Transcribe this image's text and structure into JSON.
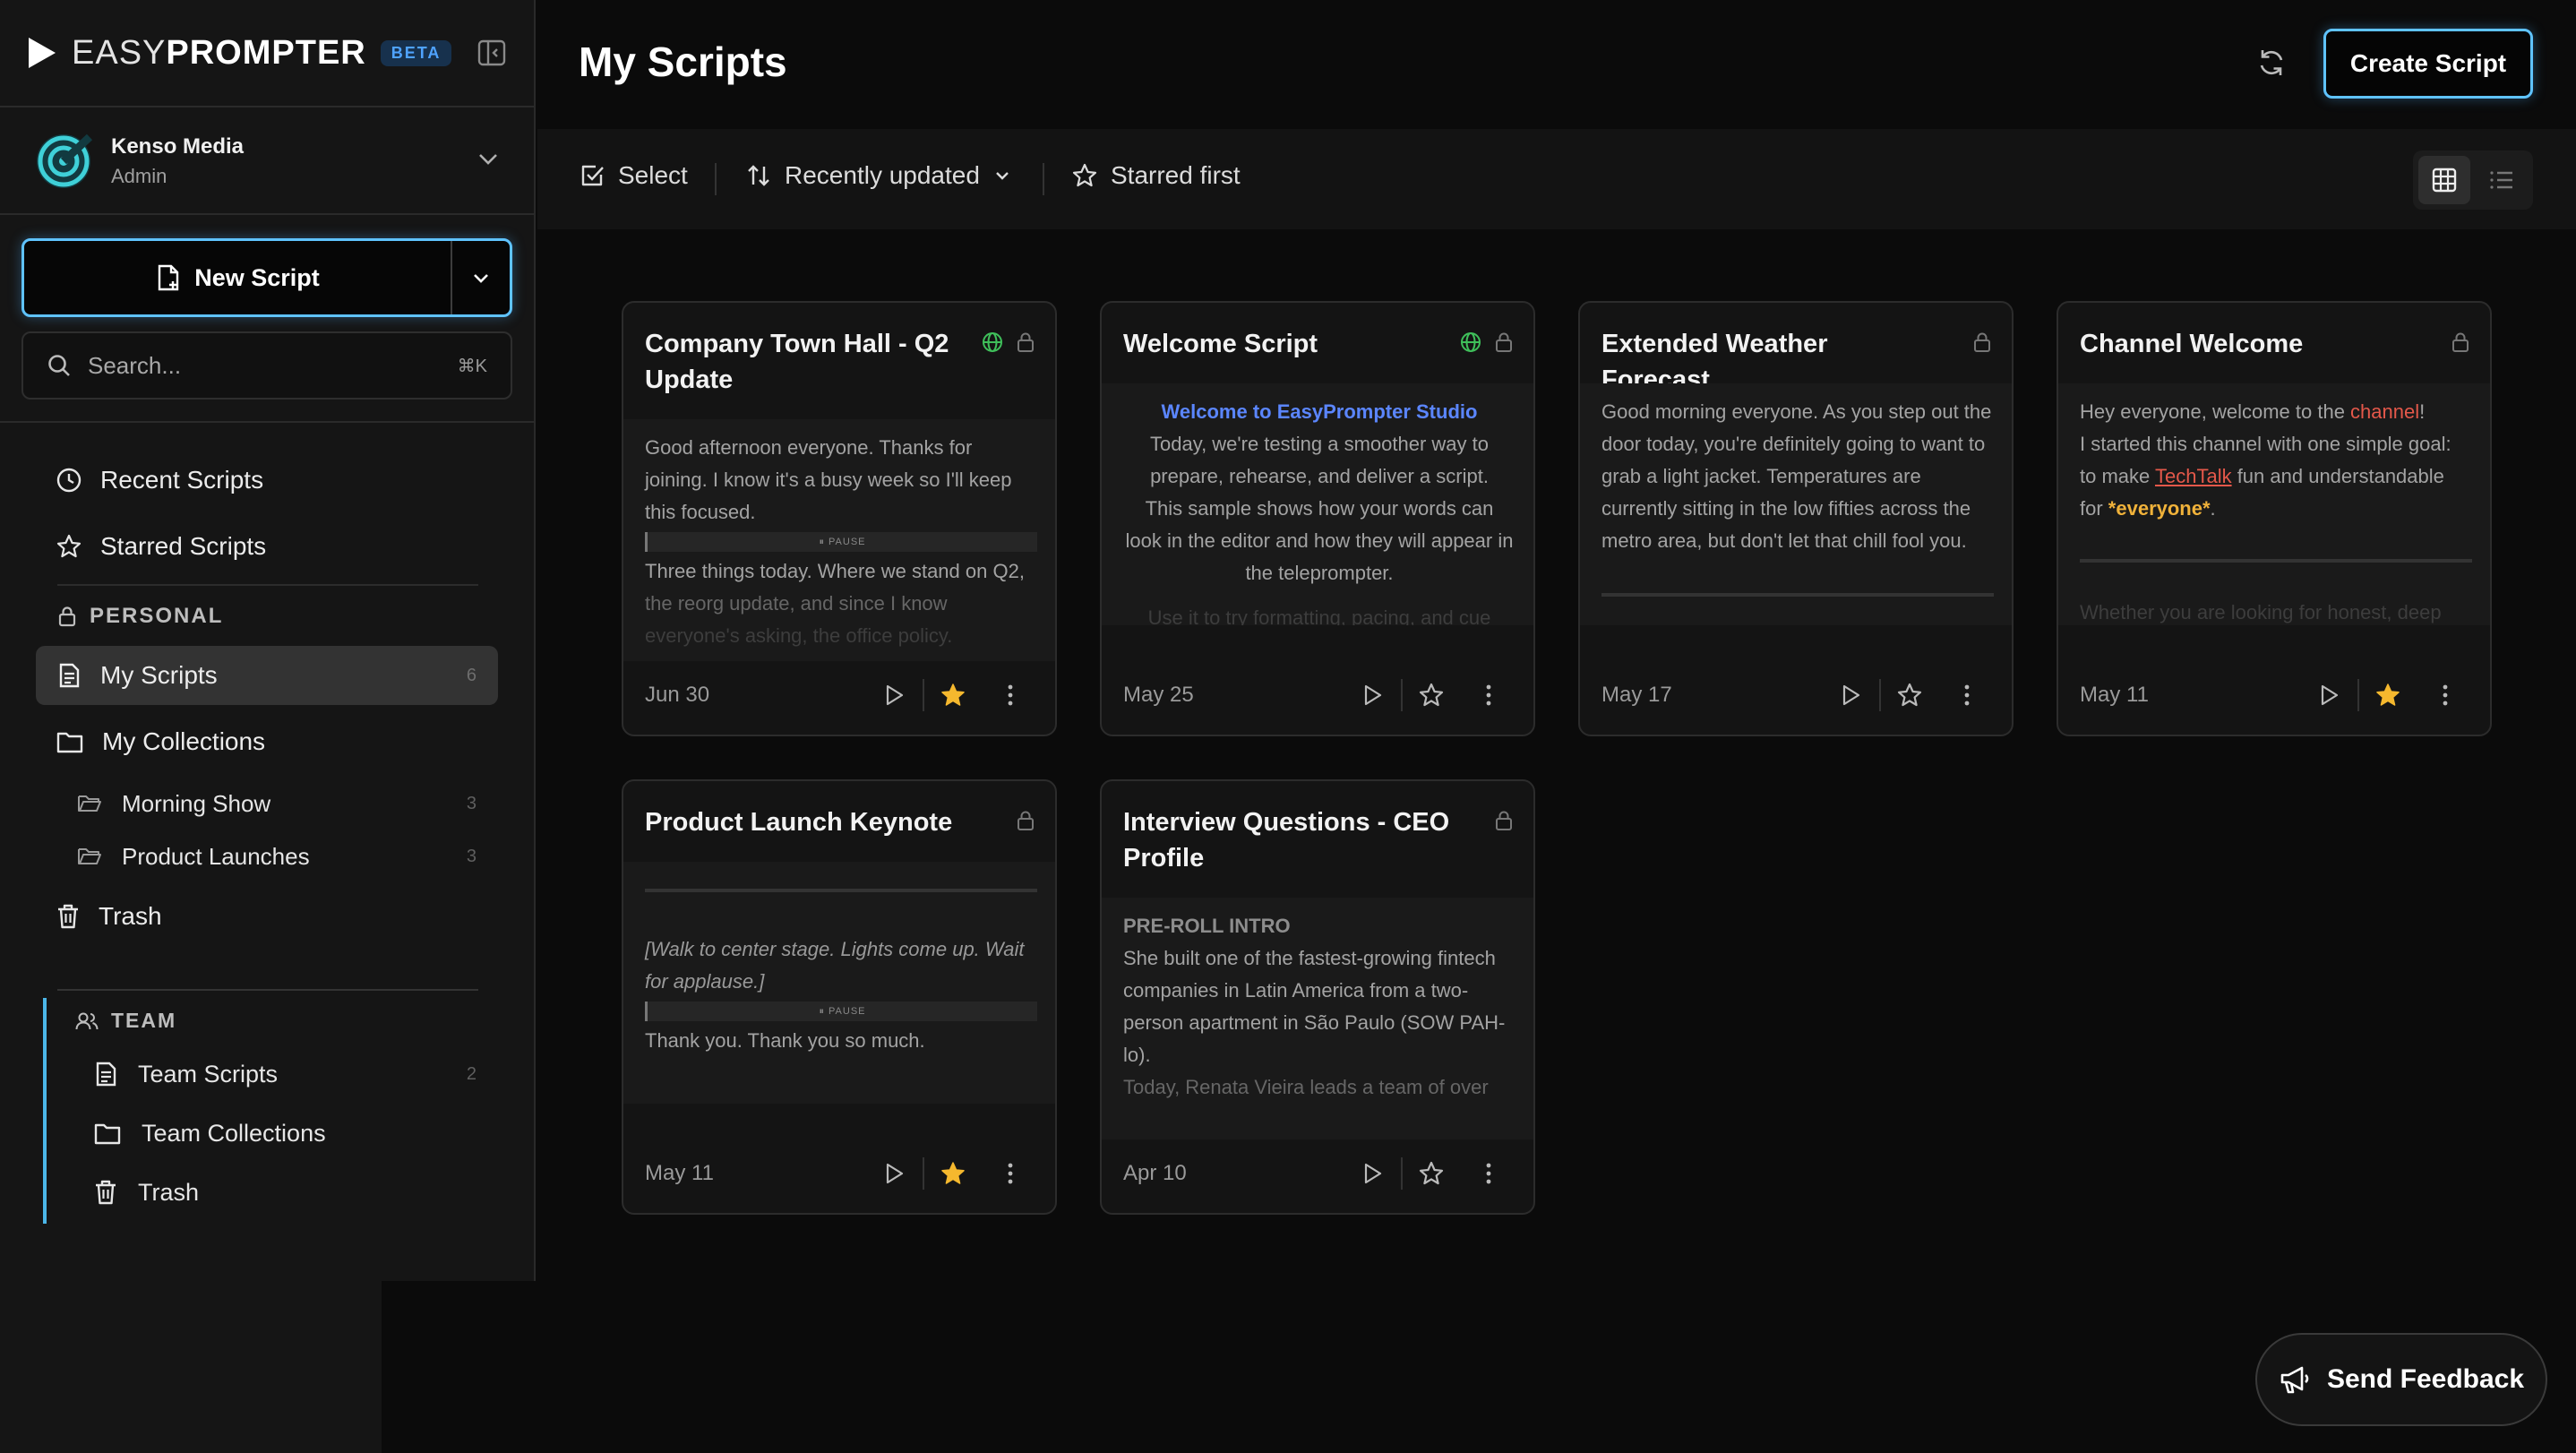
{
  "brand": {
    "name_light": "EASY",
    "name_bold": "PROMPTER",
    "badge": "BETA"
  },
  "org": {
    "name": "Kenso Media",
    "role": "Admin"
  },
  "new_script": {
    "label": "New Script"
  },
  "search": {
    "placeholder": "Search...",
    "shortcut": "⌘K"
  },
  "nav": {
    "recent": "Recent Scripts",
    "starred": "Starred Scripts",
    "personal_label": "PERSONAL",
    "my_scripts": "My Scripts",
    "my_scripts_count": "6",
    "my_collections": "My Collections",
    "collections": [
      {
        "label": "Morning Show",
        "count": "3"
      },
      {
        "label": "Product Launches",
        "count": "3"
      }
    ],
    "trash": "Trash",
    "team_label": "TEAM",
    "team_scripts": "Team Scripts",
    "team_scripts_count": "2",
    "team_collections": "Team Collections",
    "team_trash": "Trash"
  },
  "header": {
    "title": "My Scripts",
    "create_label": "Create Script"
  },
  "toolbar": {
    "select": "Select",
    "sort": "Recently updated",
    "starred_first": "Starred first"
  },
  "cards": [
    {
      "title": "Company Town Hall - Q2 Update",
      "date": "Jun 30",
      "starred": true,
      "public": true,
      "body": [
        "Good afternoon everyone. Thanks for",
        "joining. I know it's a busy week so I'll keep",
        "this focused.",
        "Three things today. Where we stand on Q2,",
        "the reorg update, and since I know",
        "everyone's asking, the office policy."
      ],
      "pause": "⏸ PAUSE"
    },
    {
      "title": "Welcome Script",
      "date": "May 25",
      "starred": false,
      "public": true,
      "heading": "Welcome to EasyPrompter Studio",
      "body": [
        "Today, we're testing a smoother way to",
        "prepare, rehearse, and deliver a script.",
        "This sample shows how your words can",
        "look in the editor and how they will appear in",
        "the teleprompter.",
        "Use it to try formatting, pacing, and cue"
      ]
    },
    {
      "title": "Extended Weather Forecast",
      "date": "May 17",
      "starred": false,
      "public": false,
      "body": [
        "Good morning everyone. As you step out the",
        "door today, you're definitely going to want to",
        "grab a light jacket. Temperatures are",
        "currently sitting in the low fifties across the",
        "metro area, but don't let that chill fool you."
      ]
    },
    {
      "title": "Channel Welcome",
      "date": "May 11",
      "starred": true,
      "public": false,
      "body_parts": {
        "l1a": "Hey everyone, welcome to the ",
        "l1b": "channel",
        "l1c": "!",
        "l2": "I started this channel with one simple goal:",
        "l3a": "to make ",
        "l3b": "TechTalk",
        "l3c": " fun and understandable",
        "l4a": "for ",
        "l4b": "*everyone*",
        "l4c": ".",
        "l5": "Whether you are looking for honest, deep"
      }
    },
    {
      "title": "Product Launch Keynote",
      "date": "May 11",
      "starred": true,
      "public": false,
      "body": [
        "[Walk to center stage. Lights come up. Wait",
        "for applause.]",
        "Thank you. Thank you so much."
      ],
      "pause": "⏸ PAUSE"
    },
    {
      "title": "Interview Questions - CEO Profile",
      "date": "Apr 10",
      "starred": false,
      "public": false,
      "heading": "PRE-ROLL INTRO",
      "body": [
        "She built one of the fastest-growing fintech",
        "companies in Latin America from a two-",
        "person apartment in São Paulo (SOW PAH-",
        "lo).",
        "Today, Renata Vieira leads a team of over"
      ]
    }
  ],
  "feedback": {
    "label": "Send Feedback"
  },
  "colors": {
    "accent": "#5fc3ff",
    "star": "#f5b82e",
    "globe": "#3fbf5a",
    "link_red": "#e4584a"
  }
}
